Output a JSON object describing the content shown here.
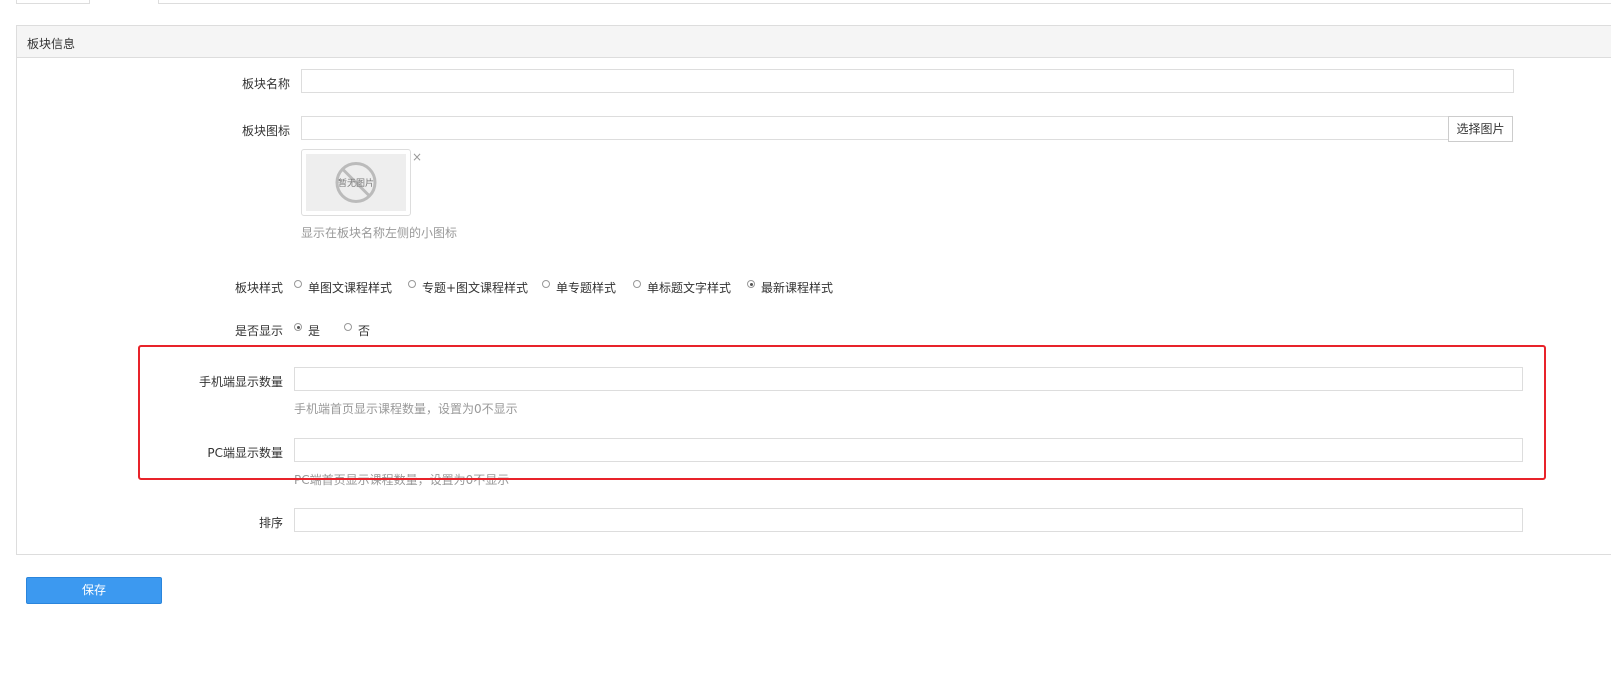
{
  "panel": {
    "title": "板块信息"
  },
  "form": {
    "block_name": {
      "label": "板块名称",
      "value": ""
    },
    "block_icon": {
      "label": "板块图标",
      "value": "",
      "choose_button": "选择图片",
      "placeholder_image_text": "暂无图片",
      "remove_glyph": "×",
      "help": "显示在板块名称左侧的小图标"
    },
    "block_style": {
      "label": "板块样式",
      "options": [
        {
          "label": "单图文课程样式",
          "checked": false
        },
        {
          "label": "专题+图文课程样式",
          "checked": false
        },
        {
          "label": "单专题样式",
          "checked": false
        },
        {
          "label": "单标题文字样式",
          "checked": false
        },
        {
          "label": "最新课程样式",
          "checked": true
        }
      ]
    },
    "show": {
      "label": "是否显示",
      "options": [
        {
          "label": "是",
          "checked": true
        },
        {
          "label": "否",
          "checked": false
        }
      ]
    },
    "mobile_count": {
      "label": "手机端显示数量",
      "value": "",
      "help": "手机端首页显示课程数量，设置为0不显示"
    },
    "pc_count": {
      "label": "PC端显示数量",
      "value": "",
      "help": "PC端首页显示课程数量，设置为0不显示"
    },
    "sort": {
      "label": "排序",
      "value": ""
    }
  },
  "actions": {
    "save_label": "保存"
  },
  "colors": {
    "primary_button": "#3c99f0",
    "highlight_border": "#e8232a",
    "help_text": "#999999"
  }
}
